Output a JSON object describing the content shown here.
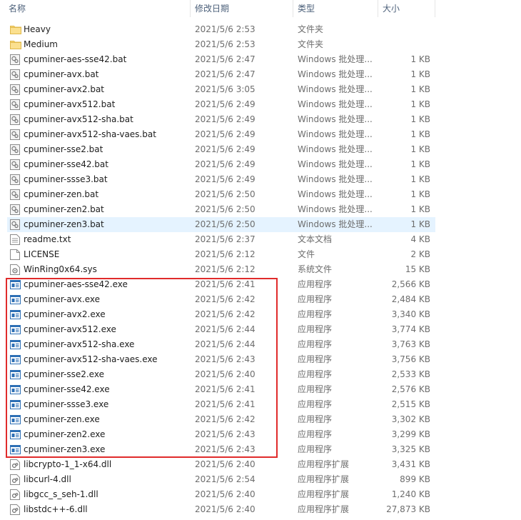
{
  "columns": {
    "name": "名称",
    "date": "修改日期",
    "type": "类型",
    "size": "大小",
    "sort_indicator": "^"
  },
  "accent": "#e02b2b",
  "selection_color": "#e5f3ff",
  "files": [
    {
      "name": "Heavy",
      "date": "2021/5/6 2:53",
      "type": "文件夹",
      "size": "",
      "icon": "folder-icon"
    },
    {
      "name": "Medium",
      "date": "2021/5/6 2:53",
      "type": "文件夹",
      "size": "",
      "icon": "folder-icon"
    },
    {
      "name": "cpuminer-aes-sse42.bat",
      "date": "2021/5/6 2:47",
      "type": "Windows 批处理...",
      "size": "1 KB",
      "icon": "batch-file-icon"
    },
    {
      "name": "cpuminer-avx.bat",
      "date": "2021/5/6 2:47",
      "type": "Windows 批处理...",
      "size": "1 KB",
      "icon": "batch-file-icon"
    },
    {
      "name": "cpuminer-avx2.bat",
      "date": "2021/5/6 3:05",
      "type": "Windows 批处理...",
      "size": "1 KB",
      "icon": "batch-file-icon"
    },
    {
      "name": "cpuminer-avx512.bat",
      "date": "2021/5/6 2:49",
      "type": "Windows 批处理...",
      "size": "1 KB",
      "icon": "batch-file-icon"
    },
    {
      "name": "cpuminer-avx512-sha.bat",
      "date": "2021/5/6 2:49",
      "type": "Windows 批处理...",
      "size": "1 KB",
      "icon": "batch-file-icon"
    },
    {
      "name": "cpuminer-avx512-sha-vaes.bat",
      "date": "2021/5/6 2:49",
      "type": "Windows 批处理...",
      "size": "1 KB",
      "icon": "batch-file-icon"
    },
    {
      "name": "cpuminer-sse2.bat",
      "date": "2021/5/6 2:49",
      "type": "Windows 批处理...",
      "size": "1 KB",
      "icon": "batch-file-icon"
    },
    {
      "name": "cpuminer-sse42.bat",
      "date": "2021/5/6 2:49",
      "type": "Windows 批处理...",
      "size": "1 KB",
      "icon": "batch-file-icon"
    },
    {
      "name": "cpuminer-ssse3.bat",
      "date": "2021/5/6 2:49",
      "type": "Windows 批处理...",
      "size": "1 KB",
      "icon": "batch-file-icon"
    },
    {
      "name": "cpuminer-zen.bat",
      "date": "2021/5/6 2:50",
      "type": "Windows 批处理...",
      "size": "1 KB",
      "icon": "batch-file-icon"
    },
    {
      "name": "cpuminer-zen2.bat",
      "date": "2021/5/6 2:50",
      "type": "Windows 批处理...",
      "size": "1 KB",
      "icon": "batch-file-icon"
    },
    {
      "name": "cpuminer-zen3.bat",
      "date": "2021/5/6 2:50",
      "type": "Windows 批处理...",
      "size": "1 KB",
      "icon": "batch-file-icon",
      "selected": true
    },
    {
      "name": "readme.txt",
      "date": "2021/5/6 2:37",
      "type": "文本文档",
      "size": "4 KB",
      "icon": "text-file-icon"
    },
    {
      "name": "LICENSE",
      "date": "2021/5/6 2:12",
      "type": "文件",
      "size": "2 KB",
      "icon": "blank-file-icon"
    },
    {
      "name": "WinRing0x64.sys",
      "date": "2021/5/6 2:12",
      "type": "系统文件",
      "size": "15 KB",
      "icon": "system-file-icon"
    },
    {
      "name": "cpuminer-aes-sse42.exe",
      "date": "2021/5/6 2:41",
      "type": "应用程序",
      "size": "2,566 KB",
      "icon": "exe-icon"
    },
    {
      "name": "cpuminer-avx.exe",
      "date": "2021/5/6 2:42",
      "type": "应用程序",
      "size": "2,484 KB",
      "icon": "exe-icon"
    },
    {
      "name": "cpuminer-avx2.exe",
      "date": "2021/5/6 2:42",
      "type": "应用程序",
      "size": "3,340 KB",
      "icon": "exe-icon"
    },
    {
      "name": "cpuminer-avx512.exe",
      "date": "2021/5/6 2:44",
      "type": "应用程序",
      "size": "3,774 KB",
      "icon": "exe-icon"
    },
    {
      "name": "cpuminer-avx512-sha.exe",
      "date": "2021/5/6 2:44",
      "type": "应用程序",
      "size": "3,763 KB",
      "icon": "exe-icon"
    },
    {
      "name": "cpuminer-avx512-sha-vaes.exe",
      "date": "2021/5/6 2:43",
      "type": "应用程序",
      "size": "3,756 KB",
      "icon": "exe-icon"
    },
    {
      "name": "cpuminer-sse2.exe",
      "date": "2021/5/6 2:40",
      "type": "应用程序",
      "size": "2,533 KB",
      "icon": "exe-icon"
    },
    {
      "name": "cpuminer-sse42.exe",
      "date": "2021/5/6 2:41",
      "type": "应用程序",
      "size": "2,576 KB",
      "icon": "exe-icon"
    },
    {
      "name": "cpuminer-ssse3.exe",
      "date": "2021/5/6 2:41",
      "type": "应用程序",
      "size": "2,515 KB",
      "icon": "exe-icon"
    },
    {
      "name": "cpuminer-zen.exe",
      "date": "2021/5/6 2:42",
      "type": "应用程序",
      "size": "3,302 KB",
      "icon": "exe-icon"
    },
    {
      "name": "cpuminer-zen2.exe",
      "date": "2021/5/6 2:43",
      "type": "应用程序",
      "size": "3,299 KB",
      "icon": "exe-icon"
    },
    {
      "name": "cpuminer-zen3.exe",
      "date": "2021/5/6 2:43",
      "type": "应用程序",
      "size": "3,325 KB",
      "icon": "exe-icon"
    },
    {
      "name": "libcrypto-1_1-x64.dll",
      "date": "2021/5/6 2:40",
      "type": "应用程序扩展",
      "size": "3,431 KB",
      "icon": "dll-icon"
    },
    {
      "name": "libcurl-4.dll",
      "date": "2021/5/6 2:54",
      "type": "应用程序扩展",
      "size": "899 KB",
      "icon": "dll-icon"
    },
    {
      "name": "libgcc_s_seh-1.dll",
      "date": "2021/5/6 2:40",
      "type": "应用程序扩展",
      "size": "1,240 KB",
      "icon": "dll-icon"
    },
    {
      "name": "libstdc++-6.dll",
      "date": "2021/5/6 2:40",
      "type": "应用程序扩展",
      "size": "27,873 KB",
      "icon": "dll-icon"
    }
  ]
}
